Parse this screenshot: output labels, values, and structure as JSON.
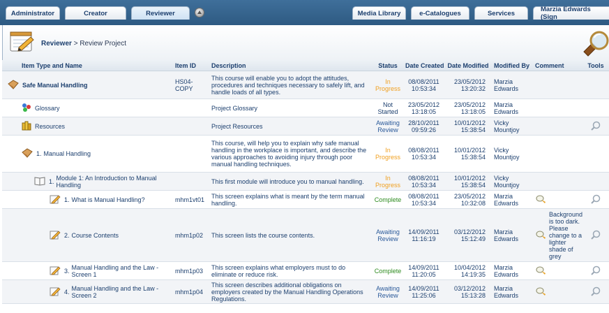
{
  "tabs": {
    "administrator": "Administrator",
    "creator": "Creator",
    "reviewer": "Reviewer",
    "media_library": "Media Library",
    "ecatalogues": "e-Catalogues",
    "services": "Services",
    "user": "Marzia Edwards (Sign"
  },
  "breadcrumb": {
    "section": "Reviewer",
    "separator": " > ",
    "current": "Review Project"
  },
  "columns": {
    "item": "Item Type and Name",
    "id": "Item ID",
    "description": "Description",
    "status": "Status",
    "created": "Date Created",
    "modified": "Date Modified",
    "modified_by": "Modified By",
    "comment": "Comment",
    "tools": "Tools"
  },
  "rows": [
    {
      "num": "",
      "name": "Safe Manual Handling",
      "id": "HS04-COPY",
      "description": "This course will enable you to adopt the attitudes, procedures and techniques necessary to safely lift, and handle loads of all types.",
      "status": "In Progress",
      "created_date": "08/08/2011",
      "created_time": "10:53:34",
      "modified_date": "23/05/2012",
      "modified_time": "13:20:32",
      "by_first": "Marzia",
      "by_last": "Edwards",
      "comment": ""
    },
    {
      "num": "",
      "name": "Glossary",
      "id": "",
      "description": "Project Glossary",
      "status": "Not Started",
      "created_date": "23/05/2012",
      "created_time": "13:18:05",
      "modified_date": "23/05/2012",
      "modified_time": "13:18:05",
      "by_first": "Marzia",
      "by_last": "Edwards",
      "comment": ""
    },
    {
      "num": "",
      "name": "Resources",
      "id": "",
      "description": "Project Resources",
      "status": "Awaiting Review",
      "created_date": "28/10/2011",
      "created_time": "09:59:26",
      "modified_date": "10/01/2012",
      "modified_time": "15:38:54",
      "by_first": "Vicky",
      "by_last": "Mountjoy",
      "comment": ""
    },
    {
      "num": "1.",
      "name": "Manual Handling",
      "id": "",
      "description": "This course, will help you to explain why safe manual handling in the workplace is important, and describe the various approaches to avoiding injury through poor manual handling techniques.",
      "status": "In Progress",
      "created_date": "08/08/2011",
      "created_time": "10:53:34",
      "modified_date": "10/01/2012",
      "modified_time": "15:38:54",
      "by_first": "Vicky",
      "by_last": "Mountjoy",
      "comment": ""
    },
    {
      "num": "1.",
      "name": "Module 1: An Introduction to Manual Handling",
      "id": "",
      "description": "This first module will introduce you to manual handling.",
      "status": "In Progress",
      "created_date": "08/08/2011",
      "created_time": "10:53:34",
      "modified_date": "10/01/2012",
      "modified_time": "15:38:54",
      "by_first": "Vicky",
      "by_last": "Mountjoy",
      "comment": ""
    },
    {
      "num": "1.",
      "name": "What is Manual Handling?",
      "id": "mhm1vt01",
      "description": "This screen explains what is meant by the term manual handling.",
      "status": "Complete",
      "created_date": "08/08/2011",
      "created_time": "10:53:34",
      "modified_date": "23/05/2012",
      "modified_time": "10:32:08",
      "by_first": "Marzia",
      "by_last": "Edwards",
      "comment": ""
    },
    {
      "num": "2.",
      "name": "Course Contents",
      "id": "mhm1p02",
      "description": "This screen lists the course contents.",
      "status": "Awaiting Review",
      "created_date": "14/09/2011",
      "created_time": "11:16:19",
      "modified_date": "03/12/2012",
      "modified_time": "15:12:49",
      "by_first": "Marzia",
      "by_last": "Edwards",
      "comment": "Background is too dark. Please change to a lighter shade of grey"
    },
    {
      "num": "3.",
      "name": "Manual Handling and the Law - Screen 1",
      "id": "mhm1p03",
      "description": "This screen explains what employers must to do eliminate or reduce risk.",
      "status": "Complete",
      "created_date": "14/09/2011",
      "created_time": "11:20:05",
      "modified_date": "10/04/2012",
      "modified_time": "14:19:35",
      "by_first": "Marzia",
      "by_last": "Edwards",
      "comment": ""
    },
    {
      "num": "4.",
      "name": "Manual Handling and the Law - Screen 2",
      "id": "mhm1p04",
      "description": "This screen describes additional obligations on employers created by the Manual Handling Operations Regulations.",
      "status": "Awaiting Review",
      "created_date": "14/09/2011",
      "created_time": "11:25:06",
      "modified_date": "03/12/2012",
      "modified_time": "15:13:28",
      "by_first": "Marzia",
      "by_last": "Edwards",
      "comment": ""
    }
  ]
}
